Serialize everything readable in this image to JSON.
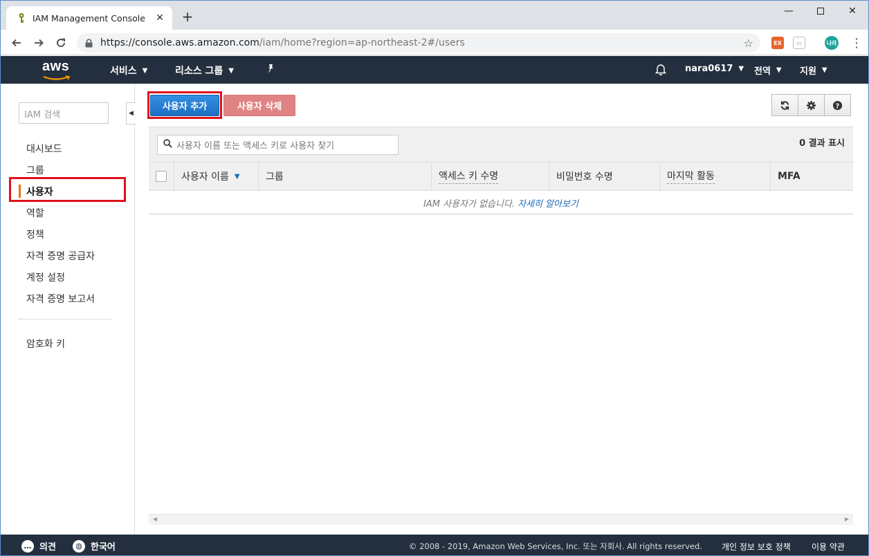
{
  "browser": {
    "tab_title": "IAM Management Console",
    "url_host": "https://console.aws.amazon.com",
    "url_path": "/iam/home?region=ap-northeast-2#/users",
    "ext1_label": "EX",
    "profile_label": "나라"
  },
  "aws_nav": {
    "logo": "aws",
    "services": "서비스",
    "resource_groups": "리소스 그룹",
    "user": "nara0617",
    "region": "전역",
    "support": "지원"
  },
  "sidebar": {
    "search_placeholder": "IAM 검색",
    "items": [
      "대시보드",
      "그룹",
      "사용자",
      "역할",
      "정책",
      "자격 증명 공급자",
      "계정 설정",
      "자격 증명 보고서"
    ],
    "active_index": 2,
    "extra_items": [
      "암호화 키"
    ]
  },
  "main": {
    "add_user_label": "사용자 추가",
    "delete_user_label": "사용자 삭제",
    "search_placeholder": "사용자 이름 또는 액세스 키로 사용자 찾기",
    "result_count": "0 결과 표시",
    "columns": [
      "사용자 이름",
      "그룹",
      "액세스 키 수명",
      "비밀번호 수명",
      "마지막 활동",
      "MFA"
    ],
    "empty_text": "IAM 사용자가 없습니다.",
    "empty_link": "자세히 알아보기"
  },
  "footer": {
    "feedback": "의견",
    "language": "한국어",
    "copyright": "© 2008 - 2019, Amazon Web Services, Inc. 또는 자회사. All rights reserved.",
    "privacy": "개인 정보 보호 정책",
    "terms": "이용 약관"
  },
  "colors": {
    "aws_nav_bg": "#232f3e",
    "accent_orange": "#ec7211",
    "primary_blue": "#1b6fc2",
    "highlight_red": "#e0101a"
  }
}
